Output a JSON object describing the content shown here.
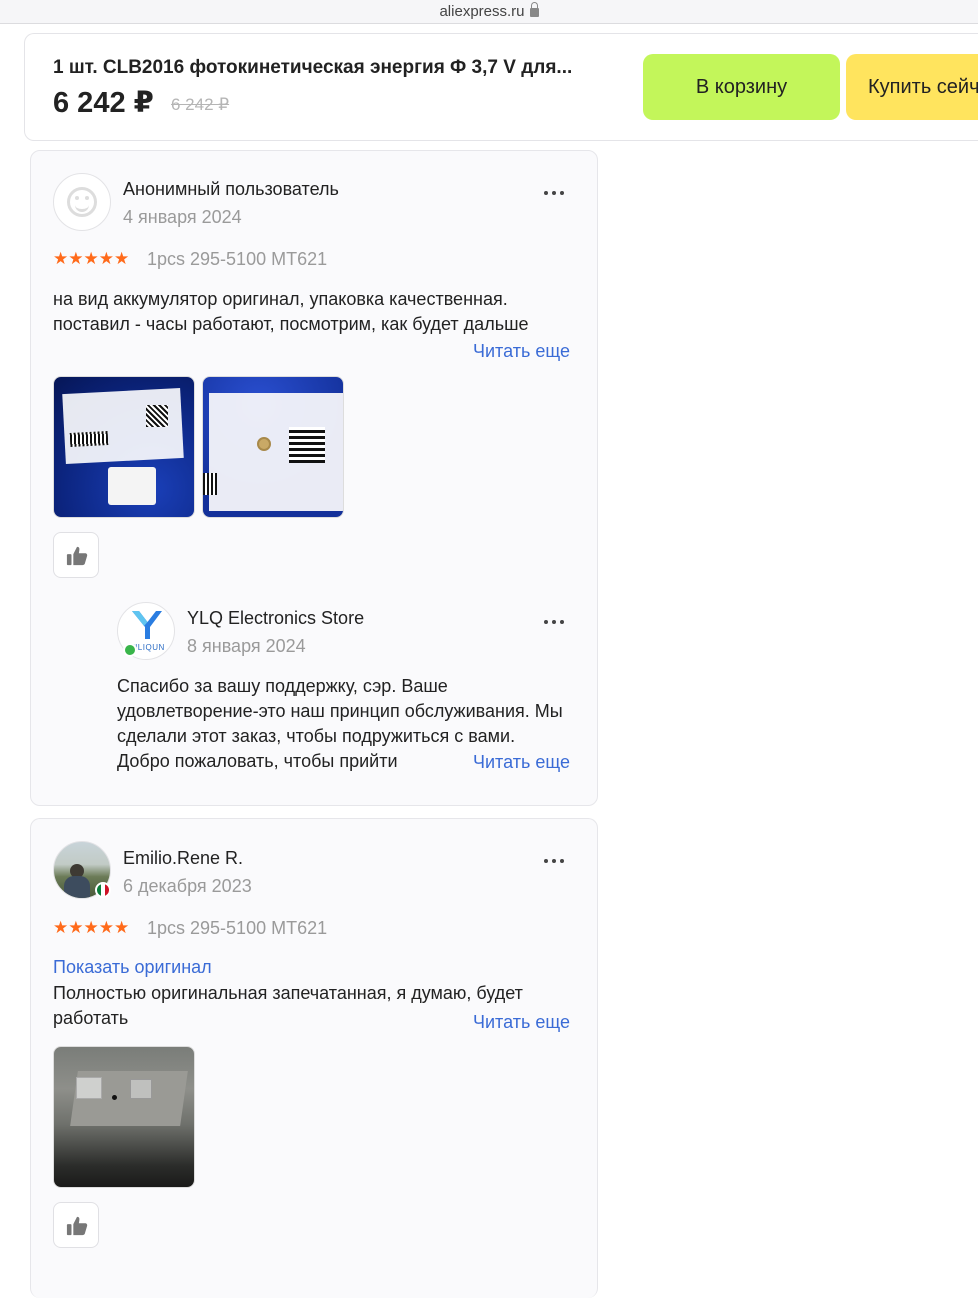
{
  "browser": {
    "url": "aliexpress.ru"
  },
  "product": {
    "title": "1 шт. CLB2016 фотокинетическая энергия Ф 3,7 V для...",
    "price": "6 242 ₽",
    "old_price": "6 242 ₽",
    "cart_label": "В корзину",
    "buy_label": "Купить сейчас"
  },
  "reviews": [
    {
      "author": "Анонимный пользователь",
      "date": "4 января 2024",
      "rating": 5,
      "stars": "★★★★★",
      "variant": "1pcs 295-5100 MT621",
      "text": "на вид аккумулятор оригинал, упаковка качественная. поставил - часы работают, посмотрим, как будет дальше",
      "read_more": "Читать еще",
      "images": [
        {
          "icon": "product-package-photo"
        },
        {
          "icon": "product-package-photo"
        }
      ],
      "reply": {
        "author": "YLQ Electronics Store",
        "logo_text": "YILIQUN",
        "date": "8 января 2024",
        "text": "Спасибо за вашу поддержку, сэр. Ваше удовлетворение-это наш принцип обслуживания. Мы сделали этот заказ, чтобы подружиться с вами. Добро пожаловать, чтобы прийти",
        "read_more": "Читать еще"
      }
    },
    {
      "author": "Emilio.Rene R.",
      "date": "6 декабря 2023",
      "rating": 5,
      "stars": "★★★★★",
      "variant": "1pcs 295-5100 MT621",
      "show_original": "Показать оригинал",
      "text": "Полностью оригинальная запечатанная, я думаю, будет работать",
      "read_more": "Читать еще",
      "country_flag": "mexico-flag-icon",
      "images": [
        {
          "icon": "product-photo"
        }
      ]
    }
  ],
  "colors": {
    "cart_button": "#c3f65a",
    "buy_button": "#ffe45e",
    "stars": "#ff6a1a",
    "link": "#3a6bd6"
  }
}
